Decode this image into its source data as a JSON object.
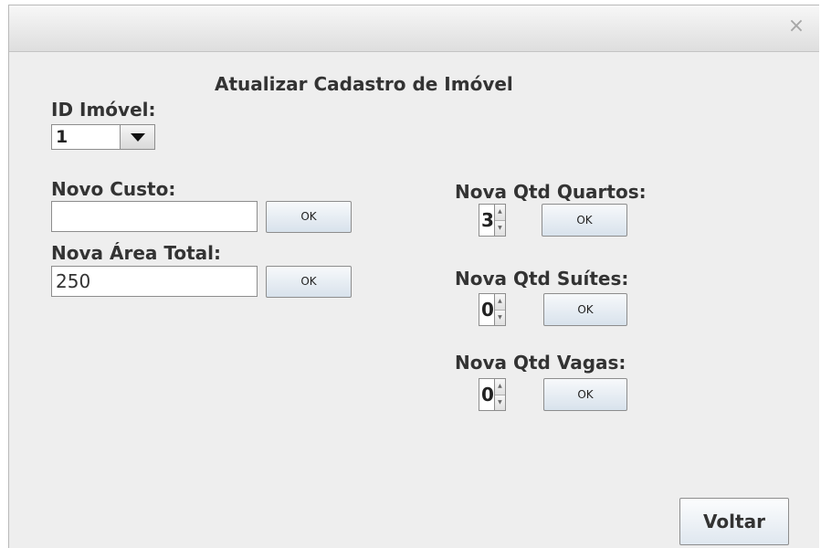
{
  "window": {
    "close_symbol": "×"
  },
  "form": {
    "title": "Atualizar Cadastro de Imóvel",
    "id_label": "ID Imóvel:",
    "id_value": "1",
    "custo_label": "Novo Custo:",
    "custo_value": "",
    "area_label": "Nova Área Total:",
    "area_value": "250",
    "quartos_label": "Nova Qtd Quartos:",
    "quartos_value": "3",
    "suites_label": "Nova Qtd Suítes:",
    "suites_value": "0",
    "vagas_label": "Nova Qtd Vagas:",
    "vagas_value": "0",
    "ok_label": "OK",
    "back_label": "Voltar"
  },
  "icons": {
    "close": "close-icon",
    "dropdown": "chevron-down-icon",
    "spin_up": "arrow-up-icon",
    "spin_down": "arrow-down-icon"
  }
}
